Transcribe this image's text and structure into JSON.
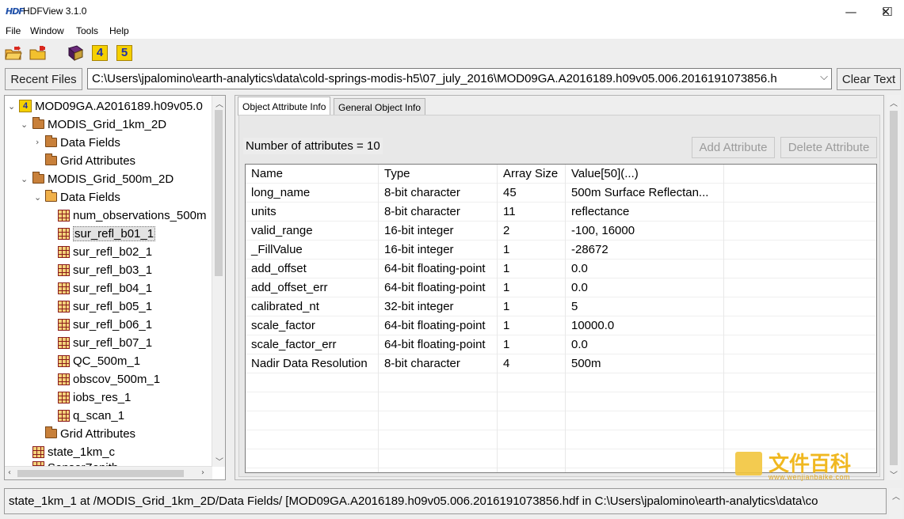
{
  "window": {
    "logo": "HDF",
    "title": "HDFView 3.1.0",
    "minimize": "—",
    "maximize": "☐",
    "close": "✕"
  },
  "menu": [
    "File",
    "Window",
    "Tools",
    "Help"
  ],
  "toolbar": {
    "icons": [
      "open-file-icon",
      "open-folder-icon",
      "users-guide-icon",
      "hdf4-library-icon",
      "hdf5-library-icon"
    ],
    "hdf4_label": "4",
    "hdf5_label": "5"
  },
  "recent": {
    "button": "Recent Files",
    "path": "C:\\Users\\jpalomino\\earth-analytics\\data\\cold-springs-modis-h5\\07_july_2016\\MOD09GA.A2016189.h09v05.006.2016191073856.h",
    "dropdown_arrow": "⌵",
    "clear": "Clear Text"
  },
  "tree": {
    "file": "MOD09GA.A2016189.h09v05.0",
    "grid_1km": "MODIS_Grid_1km_2D",
    "data_fields_1km": "Data Fields",
    "grid_attrs_1km": "Grid Attributes",
    "grid_500m": "MODIS_Grid_500m_2D",
    "data_fields_500m": "Data Fields",
    "datasets": [
      "num_observations_500m",
      "sur_refl_b01_1",
      "sur_refl_b02_1",
      "sur_refl_b03_1",
      "sur_refl_b04_1",
      "sur_refl_b05_1",
      "sur_refl_b06_1",
      "sur_refl_b07_1",
      "QC_500m_1",
      "obscov_500m_1",
      "iobs_res_1",
      "q_scan_1"
    ],
    "grid_attrs_500m": "Grid Attributes",
    "state_1km": "state_1km_c",
    "partial": "SensorZenith"
  },
  "tabs": {
    "attr": "Object Attribute Info",
    "general": "General Object Info"
  },
  "attributes": {
    "count_label": "Number of attributes = 10",
    "add_button": "Add Attribute",
    "delete_button": "Delete Attribute",
    "columns": [
      "Name",
      "Type",
      "Array Size",
      "Value[50](...)"
    ],
    "rows": [
      [
        "long_name",
        "8-bit character",
        "45",
        "500m Surface Reflectan..."
      ],
      [
        "units",
        "8-bit character",
        "11",
        "reflectance"
      ],
      [
        "valid_range",
        "16-bit integer",
        "2",
        "-100, 16000"
      ],
      [
        "_FillValue",
        "16-bit integer",
        "1",
        "-28672"
      ],
      [
        "add_offset",
        "64-bit floating-point",
        "1",
        "0.0"
      ],
      [
        "add_offset_err",
        "64-bit floating-point",
        "1",
        "0.0"
      ],
      [
        "calibrated_nt",
        "32-bit integer",
        "1",
        "5"
      ],
      [
        "scale_factor",
        "64-bit floating-point",
        "1",
        "10000.0"
      ],
      [
        "scale_factor_err",
        "64-bit floating-point",
        "1",
        "0.0"
      ],
      [
        "Nadir Data Resolution",
        "8-bit character",
        "4",
        "500m"
      ]
    ]
  },
  "status": {
    "text": "state_1km_1  at  /MODIS_Grid_1km_2D/Data Fields/  [MOD09GA.A2016189.h09v05.006.2016191073856.hdf  in  C:\\Users\\jpalomino\\earth-analytics\\data\\co"
  },
  "watermark": {
    "text": "文件百科",
    "url": "www.wenjianbaike.com"
  }
}
